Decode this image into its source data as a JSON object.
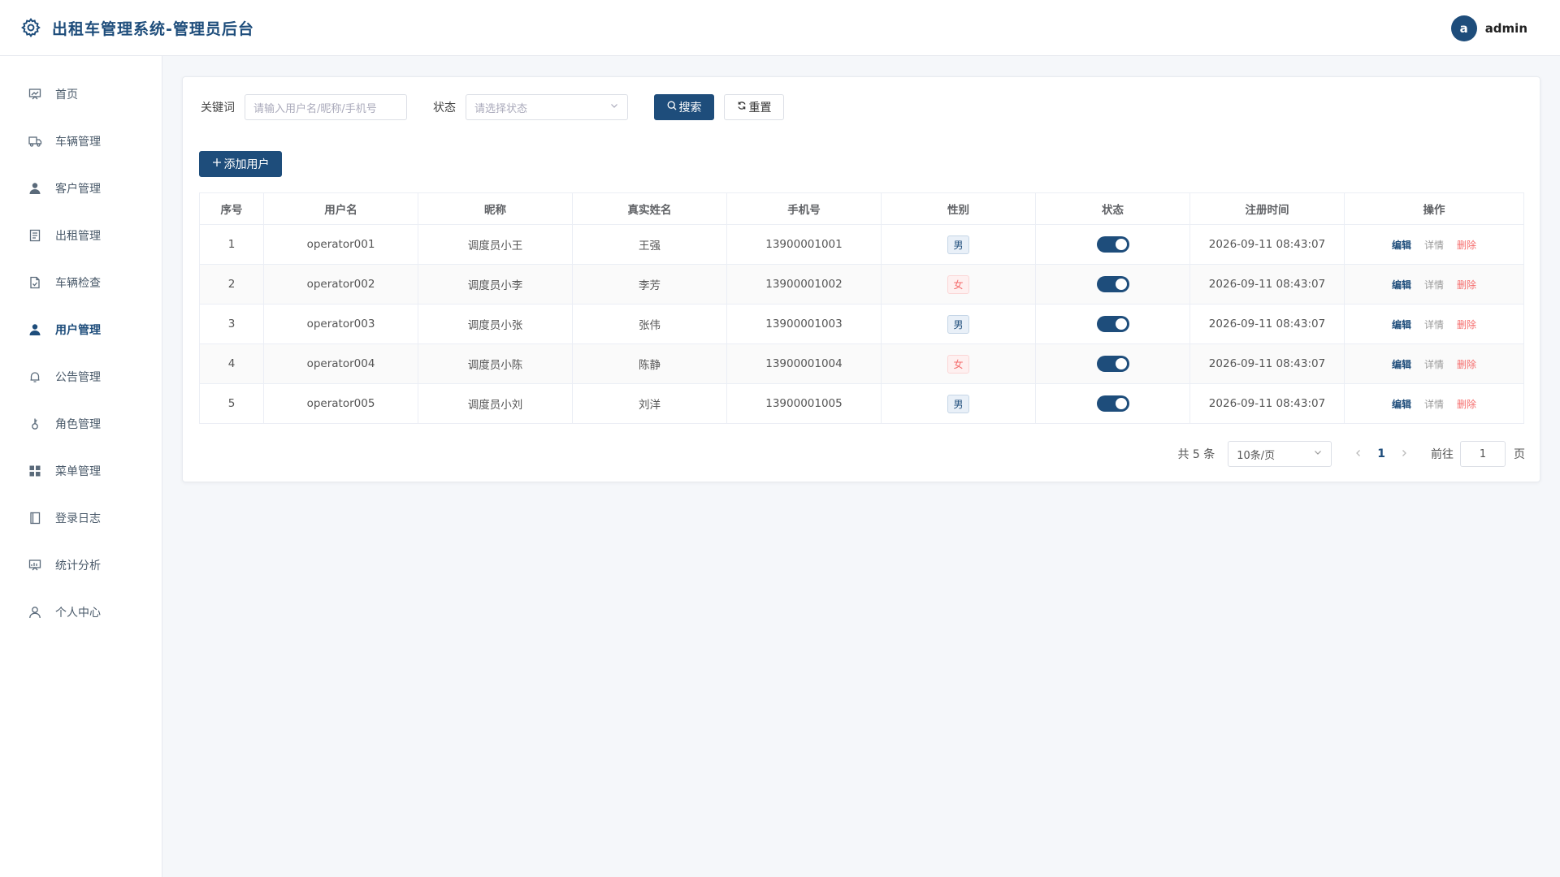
{
  "header": {
    "title": "出租车管理系统-管理员后台",
    "user": {
      "avatar_letter": "a",
      "name": "admin"
    }
  },
  "sidebar": {
    "items": [
      {
        "label": "首页",
        "icon": "dashboard-icon",
        "active": false
      },
      {
        "label": "车辆管理",
        "icon": "truck-icon",
        "active": false
      },
      {
        "label": "客户管理",
        "icon": "user-icon",
        "active": false
      },
      {
        "label": "出租管理",
        "icon": "document-icon",
        "active": false
      },
      {
        "label": "车辆检查",
        "icon": "file-check-icon",
        "active": false
      },
      {
        "label": "用户管理",
        "icon": "user-filled-icon",
        "active": true
      },
      {
        "label": "公告管理",
        "icon": "bell-icon",
        "active": false
      },
      {
        "label": "角色管理",
        "icon": "key-icon",
        "active": false
      },
      {
        "label": "菜单管理",
        "icon": "grid-icon",
        "active": false
      },
      {
        "label": "登录日志",
        "icon": "notebook-icon",
        "active": false
      },
      {
        "label": "统计分析",
        "icon": "chart-board-icon",
        "active": false
      },
      {
        "label": "个人中心",
        "icon": "person-outline-icon",
        "active": false
      }
    ]
  },
  "filters": {
    "keyword_label": "关键词",
    "keyword_placeholder": "请输入用户名/昵称/手机号",
    "status_label": "状态",
    "status_placeholder": "请选择状态",
    "search_label": "搜索",
    "reset_label": "重置"
  },
  "actions": {
    "add_label": "添加用户"
  },
  "table": {
    "columns": [
      "序号",
      "用户名",
      "昵称",
      "真实姓名",
      "手机号",
      "性别",
      "状态",
      "注册时间",
      "操作"
    ],
    "rows": [
      {
        "index": "1",
        "username": "operator001",
        "nickname": "调度员小王",
        "realname": "王强",
        "phone": "13900001001",
        "gender": "男",
        "enabled": true,
        "created": "2026-09-11 08:43:07"
      },
      {
        "index": "2",
        "username": "operator002",
        "nickname": "调度员小李",
        "realname": "李芳",
        "phone": "13900001002",
        "gender": "女",
        "enabled": true,
        "created": "2026-09-11 08:43:07"
      },
      {
        "index": "3",
        "username": "operator003",
        "nickname": "调度员小张",
        "realname": "张伟",
        "phone": "13900001003",
        "gender": "男",
        "enabled": true,
        "created": "2026-09-11 08:43:07"
      },
      {
        "index": "4",
        "username": "operator004",
        "nickname": "调度员小陈",
        "realname": "陈静",
        "phone": "13900001004",
        "gender": "女",
        "enabled": true,
        "created": "2026-09-11 08:43:07"
      },
      {
        "index": "5",
        "username": "operator005",
        "nickname": "调度员小刘",
        "realname": "刘洋",
        "phone": "13900001005",
        "gender": "男",
        "enabled": true,
        "created": "2026-09-11 08:43:07"
      }
    ],
    "op_edit": "编辑",
    "op_detail": "详情",
    "op_delete": "删除"
  },
  "pagination": {
    "total_text": "共 5 条",
    "page_size": "10条/页",
    "current_page": "1",
    "goto_label": "前往",
    "goto_value": "1",
    "goto_suffix": "页"
  },
  "colors": {
    "primary": "#1e4d7b",
    "danger": "#f56c6c",
    "background": "#f5f7fa"
  }
}
